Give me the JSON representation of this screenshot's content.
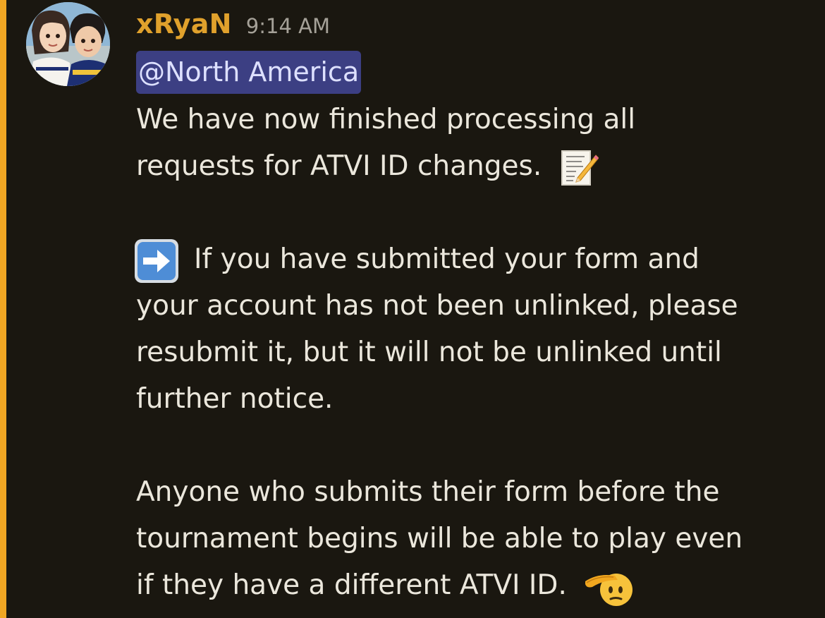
{
  "message": {
    "author": "xRyaN",
    "timestamp": "9:14 AM",
    "mention": "@North America",
    "lines": [
      "We have now finished processing all",
      "requests for ATVI ID changes.",
      "",
      "If you have submitted your form and",
      "your account has not been unlinked, please",
      "resubmit it, but it will not be unlinked until",
      "further notice.",
      "",
      "Anyone who submits their form before the",
      "tournament begins will be able to play even",
      "if they have a different ATVI ID."
    ],
    "emojis": {
      "line2": "memo-emoji",
      "line4": "right-arrow-emoji",
      "line11": "saluting-face-emoji"
    }
  },
  "colors": {
    "background": "#1a1710",
    "accent_bar": "#f0a623",
    "username": "#e0a12c",
    "mention_bg": "#3c3f83",
    "text": "#ebe7dc",
    "timestamp": "#a5a198"
  }
}
